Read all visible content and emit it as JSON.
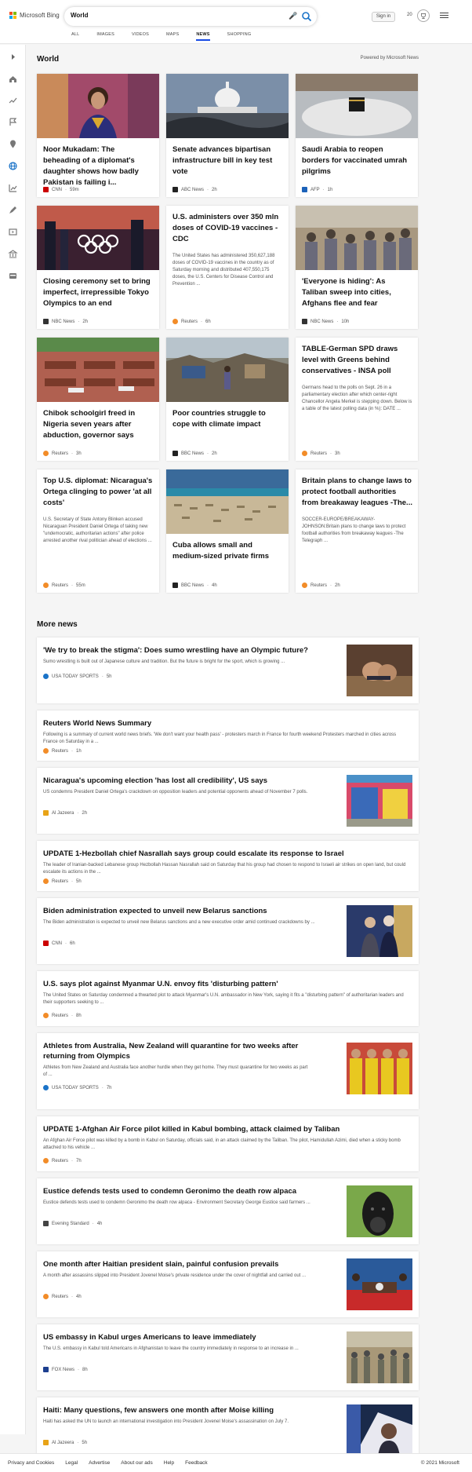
{
  "header": {
    "logo_text": "Microsoft Bing",
    "search_query": "World",
    "sign_in": "Sign in",
    "rewards_count": "20"
  },
  "tabs": [
    {
      "label": "ALL"
    },
    {
      "label": "IMAGES"
    },
    {
      "label": "VIDEOS"
    },
    {
      "label": "MAPS"
    },
    {
      "label": "NEWS"
    },
    {
      "label": "SHOPPING"
    }
  ],
  "world": {
    "title": "World",
    "powered_by": "Powered by Microsoft News",
    "cards": [
      {
        "title": "Noor Mukadam: The beheading of a diplomat's daughter shows how badly Pakistan is failing i...",
        "snippet": "",
        "source": "CNN",
        "time": "59m",
        "src_color": "#cc0000"
      },
      {
        "title": "Senate advances bipartisan infrastructure bill in key test vote",
        "snippet": "",
        "source": "ABC News",
        "time": "2h",
        "src_color": "#222222"
      },
      {
        "title": "Saudi Arabia to reopen borders for vaccinated umrah pilgrims",
        "snippet": "",
        "source": "AFP",
        "time": "1h",
        "src_color": "#1c62b9"
      },
      {
        "title": "Closing ceremony set to bring imperfect, irrepressible Tokyo Olympics to an end",
        "snippet": "",
        "source": "NBC News",
        "time": "2h",
        "src_color": "#333333"
      },
      {
        "title": "U.S. administers over 350 mln doses of COVID-19 vaccines - CDC",
        "snippet": "The United States has administered 350,627,188 doses of COVID-19 vaccines in the country as of Saturday morning and distributed 407,550,175 doses, the U.S. Centers for Disease Control and Prevention ...",
        "source": "Reuters",
        "time": "6h",
        "src_color": "#f28c28"
      },
      {
        "title": "'Everyone is hiding': As Taliban sweep into cities, Afghans flee and fear",
        "snippet": "",
        "source": "NBC News",
        "time": "10h",
        "src_color": "#333333"
      },
      {
        "title": "Chibok schoolgirl freed in Nigeria seven years after abduction, governor says",
        "snippet": "",
        "source": "Reuters",
        "time": "3h",
        "src_color": "#f28c28"
      },
      {
        "title": "Poor countries struggle to cope with climate impact",
        "snippet": "",
        "source": "BBC News",
        "time": "2h",
        "src_color": "#222222"
      },
      {
        "title": "TABLE-German SPD draws level with Greens behind conservatives - INSA poll",
        "snippet": "Germans head to the polls on Sept. 26 in a parliamentary election after which center-right Chancellor Angela Merkel is stepping down. Below is a table of the latest polling data (in %): DATE ...",
        "source": "Reuters",
        "time": "3h",
        "src_color": "#f28c28"
      },
      {
        "title": "Top U.S. diplomat: Nicaragua's Ortega clinging to power 'at all costs'",
        "snippet": "U.S. Secretary of State Antony Blinken accused Nicaraguan President Daniel Ortega of taking new \"undemocratic, authoritarian actions\" after police arrested another rival politician ahead of elections ...",
        "source": "Reuters",
        "time": "55m",
        "src_color": "#f28c28"
      },
      {
        "title": "Cuba allows small and medium-sized private firms",
        "snippet": "",
        "source": "BBC News",
        "time": "4h",
        "src_color": "#222222"
      },
      {
        "title": "Britain plans to change laws to protect football authorities from breakaway leagues -The...",
        "snippet": "SOCCER-EUROPE/BREAKAWAY-JOHNSON:Britain plans to change laws to protect football authorities from breakaway leagues -The Telegraph ...",
        "source": "Reuters",
        "time": "2h",
        "src_color": "#f28c28"
      }
    ]
  },
  "more_news": {
    "title": "More news",
    "items": [
      {
        "title": "'We try to break the stigma': Does sumo wrestling have an Olympic future?",
        "snippet": "Sumo wrestling is built out of Japanese culture and tradition. But the future is bright for the sport, which is growing ...",
        "source": "USA TODAY SPORTS",
        "time": "5h",
        "src_color": "#1a73c8"
      },
      {
        "title": "Reuters World News Summary",
        "snippet": "Following is a summary of current world news briefs. 'We don't want your health pass' - protesters march in France for fourth weekend Protesters marched in cities across France on Saturday in a ...",
        "source": "Reuters",
        "time": "1h",
        "src_color": "#f28c28"
      },
      {
        "title": "Nicaragua's upcoming election 'has lost all credibility', US says",
        "snippet": "US condemns President Daniel Ortega's crackdown on opposition leaders and potential opponents ahead of November 7 polls.",
        "source": "Al Jazeera",
        "time": "2h",
        "src_color": "#e8a317"
      },
      {
        "title": "UPDATE 1-Hezbollah chief Nasrallah says group could escalate its response to Israel",
        "snippet": "The leader of Iranian-backed Lebanese group Hezbollah Hassan Nasrallah said on Saturday that his group had chosen to respond to Israeli air strikes on open land, but could escalate its actions in the ...",
        "source": "Reuters",
        "time": "5h",
        "src_color": "#f28c28"
      },
      {
        "title": "Biden administration expected to unveil new Belarus sanctions",
        "snippet": "The Biden administration is expected to unveil new Belarus sanctions and a new executive order amid continued crackdowns by ...",
        "source": "CNN",
        "time": "6h",
        "src_color": "#cc0000"
      },
      {
        "title": "U.S. says plot against Myanmar U.N. envoy fits 'disturbing pattern'",
        "snippet": "The United States on Saturday condemned a thwarted plot to attack Myanmar's U.N. ambassador in New York, saying it fits a \"disturbing pattern\" of authoritarian leaders and their supporters seeking to ...",
        "source": "Reuters",
        "time": "8h",
        "src_color": "#f28c28"
      },
      {
        "title": "Athletes from Australia, New Zealand will quarantine for two weeks after returning from Olympics",
        "snippet": "Athletes from New Zealand and Australia face another hurdle when they get home. They must quarantine for two weeks as part of ...",
        "source": "USA TODAY SPORTS",
        "time": "7h",
        "src_color": "#1a73c8"
      },
      {
        "title": "UPDATE 1-Afghan Air Force pilot killed in Kabul bombing, attack claimed by Taliban",
        "snippet": "An Afghan Air Force pilot was killed by a bomb in Kabul on Saturday, officials said, in an attack claimed by the Taliban. The pilot, Hamidullah Azimi, died when a sticky bomb attached to his vehicle ...",
        "source": "Reuters",
        "time": "7h",
        "src_color": "#f28c28"
      },
      {
        "title": "Eustice defends tests used to condemn Geronimo the death row alpaca",
        "snippet": "Eustice defends tests used to condemn Geronimo the death row alpaca - Environment Secretary George Eustice said farmers ...",
        "source": "Evening Standard",
        "time": "4h",
        "src_color": "#444444"
      },
      {
        "title": "One month after Haitian president slain, painful confusion prevails",
        "snippet": "A month after assassins slipped into President Jovenel Moise's private residence under the cover of nightfall and carried out ...",
        "source": "Reuters",
        "time": "4h",
        "src_color": "#f28c28"
      },
      {
        "title": "US embassy in Kabul urges Americans to leave immediately",
        "snippet": "The U.S. embassy in Kabul told Americans in Afghanistan to leave the country immediately in response to an increase in ...",
        "source": "FOX News",
        "time": "8h",
        "src_color": "#1d3f8f"
      },
      {
        "title": "Haiti: Many questions, few answers one month after Moise killing",
        "snippet": "Haiti has asked the UN to launch an international investigation into President Jovenel Moise's assassination on July 7.",
        "source": "Al Jazeera",
        "time": "5h",
        "src_color": "#e8a317"
      }
    ]
  },
  "footer": {
    "links": [
      "Privacy and Cookies",
      "Legal",
      "Advertise",
      "About our ads",
      "Help",
      "Feedback"
    ],
    "copyright": "© 2021 Microsoft"
  }
}
